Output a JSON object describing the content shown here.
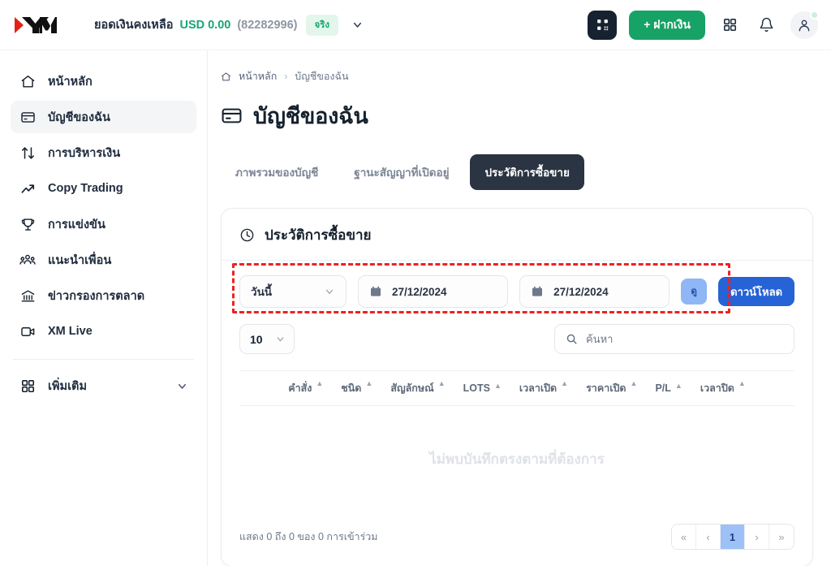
{
  "header": {
    "logo_alt": "XM",
    "balance_label": "ยอดเงินคงเหลือ",
    "balance_amount": "USD 0.00",
    "account_number": "(82282996)",
    "account_badge": "จริง",
    "deposit_label": "+ ฝากเงิน",
    "accent_green": "#17a266",
    "badge_bg": "#e3f6ec"
  },
  "sidebar": {
    "items": [
      {
        "label": "หน้าหลัก",
        "icon": "home-icon",
        "active": false
      },
      {
        "label": "บัญชีของฉัน",
        "icon": "card-icon",
        "active": true
      },
      {
        "label": "การบริหารเงิน",
        "icon": "transfer-icon",
        "active": false
      },
      {
        "label": "Copy Trading",
        "icon": "trend-up-icon",
        "active": false
      },
      {
        "label": "การแข่งขัน",
        "icon": "trophy-icon",
        "active": false
      },
      {
        "label": "แนะนำเพื่อน",
        "icon": "people-icon",
        "active": false
      },
      {
        "label": "ข่าวกรองการตลาด",
        "icon": "bank-icon",
        "active": false
      },
      {
        "label": "XM Live",
        "icon": "video-icon",
        "active": false
      }
    ],
    "more_label": "เพิ่มเติม",
    "more_icon": "grid-icon"
  },
  "breadcrumb": {
    "home": "หน้าหลัก",
    "separator": "›",
    "current": "บัญชีของฉัน"
  },
  "page": {
    "title": "บัญชีของฉัน",
    "title_icon": "card-icon"
  },
  "tabs": [
    {
      "label": "ภาพรวมของบัญชี",
      "active": false
    },
    {
      "label": "ฐานะสัญญาที่เปิดอยู่",
      "active": false
    },
    {
      "label": "ประวัติการซื้อขาย",
      "active": true
    }
  ],
  "card": {
    "title": "ประวัติการซื้อขาย",
    "title_icon": "clock-icon",
    "filters": {
      "range_select": "วันนี้",
      "date_from": "27/12/2024",
      "date_to": "27/12/2024",
      "view_button": "ดู",
      "download_button": "ดาวน์โหลด",
      "highlight_color": "#ef2121"
    },
    "page_size": "10",
    "search_placeholder": "ค้นหา",
    "search_value": "",
    "columns": [
      "คำสั่ง",
      "ชนิด",
      "สัญลักษณ์",
      "LOTS",
      "เวลาเปิด",
      "ราคาเปิด",
      "P/L",
      "เวลาปิด"
    ],
    "empty_message": "ไม่พบบันทึกตรงตามที่ต้องการ",
    "footer_info": "แสดง 0 ถึง 0 ของ 0 การเข้าร่วม",
    "pagination": {
      "first": "«",
      "prev": "‹",
      "current": "1",
      "next": "›",
      "last": "»"
    }
  }
}
